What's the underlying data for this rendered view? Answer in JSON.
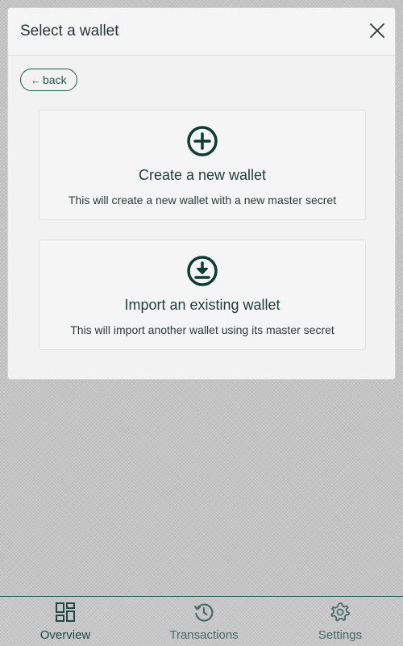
{
  "modal": {
    "title": "Select a wallet",
    "back_label": "back",
    "options": [
      {
        "title": "Create a new wallet",
        "description": "This will create a new wallet with a new master secret",
        "icon": "plus-circle-icon"
      },
      {
        "title": "Import an existing wallet",
        "description": "This will import another wallet using its master secret",
        "icon": "download-circle-icon"
      }
    ]
  },
  "bottom_nav": {
    "items": [
      {
        "label": "Overview",
        "icon": "dashboard-icon",
        "active": true
      },
      {
        "label": "Transactions",
        "icon": "history-icon",
        "active": false
      },
      {
        "label": "Settings",
        "icon": "gear-icon",
        "active": false
      }
    ]
  },
  "colors": {
    "accent": "#1f5c4a",
    "text_dark": "#233838",
    "overlay": "#c4c4c4"
  }
}
